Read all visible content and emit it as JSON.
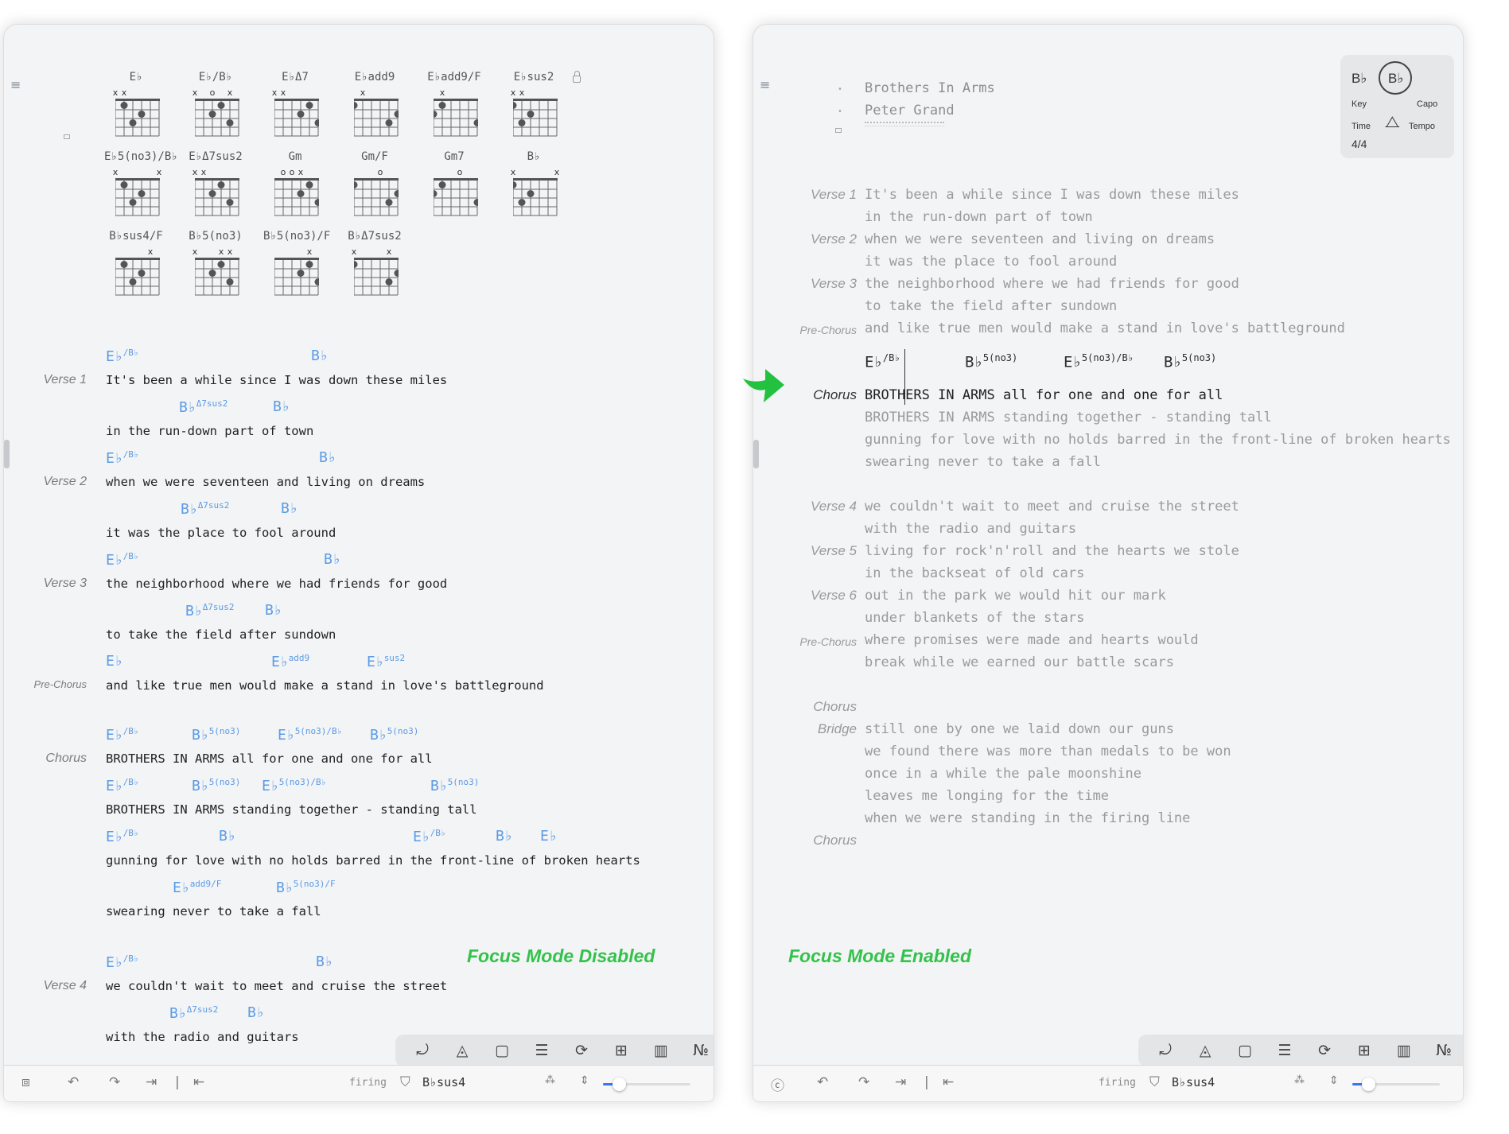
{
  "left": {
    "caption": "Focus Mode Disabled",
    "diagrams": [
      {
        "name": "E♭",
        "mutes": "xx····"
      },
      {
        "name": "E♭/B♭",
        "mutes": "x·o·x·"
      },
      {
        "name": "E♭Δ7",
        "mutes": "xx····"
      },
      {
        "name": "E♭add9",
        "mutes": "·x····"
      },
      {
        "name": "E♭add9/F",
        "mutes": "·x····"
      },
      {
        "name": "E♭sus2",
        "mutes": "xx····"
      },
      {
        "name": "E♭5(no3)/B♭",
        "mutes": "x····x"
      },
      {
        "name": "E♭Δ7sus2",
        "mutes": "xx····"
      },
      {
        "name": "Gm",
        "mutes": "·oox··"
      },
      {
        "name": "Gm/F",
        "mutes": "···o··"
      },
      {
        "name": "Gm7",
        "mutes": "···o··"
      },
      {
        "name": "B♭",
        "mutes": "x····x"
      },
      {
        "name": "B♭sus4/F",
        "mutes": "····x·"
      },
      {
        "name": "B♭5(no3)",
        "mutes": "x··xx·"
      },
      {
        "name": "B♭5(no3)/F",
        "mutes": "····x·"
      },
      {
        "name": "B♭Δ7sus2",
        "mutes": "x···x·"
      }
    ],
    "lines": [
      {
        "label": "Verse 1",
        "chords": [
          "E♭/B♭",
          "B♭"
        ],
        "lyric": "It's been a while since I was down these miles"
      },
      {
        "label": "",
        "chords": [
          "B♭Δ7sus2",
          "B♭"
        ],
        "lyric": "in the run-down part of town"
      },
      {
        "label": "Verse 2",
        "chords": [
          "E♭/B♭",
          "B♭"
        ],
        "lyric": "when we were seventeen and living on dreams"
      },
      {
        "label": "",
        "chords": [
          "B♭Δ7sus2",
          "B♭"
        ],
        "lyric": "it was the place to fool around"
      },
      {
        "label": "Verse 3",
        "chords": [
          "E♭/B♭",
          "B♭"
        ],
        "lyric": "the neighborhood where we had friends for good"
      },
      {
        "label": "",
        "chords": [
          "B♭Δ7sus2",
          "B♭"
        ],
        "lyric": "to take the field after sundown"
      },
      {
        "label": "Pre-Chorus",
        "chords": [
          "E♭",
          "E♭add9",
          "E♭sus2"
        ],
        "lyric": "and like true men would make a stand in love's battleground"
      },
      {
        "label": "Chorus",
        "chords": [
          "E♭/B♭",
          "B♭5(no3)",
          "E♭5(no3)/B♭",
          "B♭5(no3)"
        ],
        "lyric": "BROTHERS IN ARMS all for one and one for all"
      },
      {
        "label": "",
        "chords": [
          "E♭/B♭",
          "B♭5(no3)",
          "E♭5(no3)/B♭",
          "B♭5(no3)"
        ],
        "lyric": "BROTHERS IN ARMS standing together - standing tall"
      },
      {
        "label": "",
        "chords": [
          "E♭/B♭",
          "B♭",
          "E♭/B♭",
          "B♭",
          "E♭"
        ],
        "lyric": "gunning for love with no holds barred in the front-line of broken hearts"
      },
      {
        "label": "",
        "chords": [
          "E♭add9/F",
          "B♭5(no3)/F"
        ],
        "lyric": "swearing never to take a fall"
      },
      {
        "label": "Verse 4",
        "chords": [
          "E♭/B♭",
          "B♭"
        ],
        "lyric": "we couldn't wait to meet and cruise the street"
      },
      {
        "label": "",
        "chords": [
          "B♭Δ7sus2",
          "B♭"
        ],
        "lyric": "with the radio and guitars"
      }
    ]
  },
  "right": {
    "caption": "Focus Mode Enabled",
    "title": "Brothers In Arms",
    "artist": "Peter Grand",
    "info": {
      "key": "B♭",
      "key_label": "Key",
      "capo": "B♭",
      "capo_label": "Capo",
      "time_label": "Time",
      "tempo_label": "Tempo",
      "time": "4/4"
    },
    "sections": [
      {
        "label": "Verse 1",
        "lines": [
          "It's been a while since I was down these miles",
          "in the run-down part of town"
        ]
      },
      {
        "label": "Verse 2",
        "lines": [
          "when we were seventeen and living on dreams",
          "it was the place to fool around"
        ]
      },
      {
        "label": "Verse 3",
        "lines": [
          "the neighborhood where we had friends for good",
          "to take the field after sundown"
        ]
      },
      {
        "label": "Pre-Chorus",
        "lines": [
          "and like true men would make a stand in love's battleground"
        ]
      },
      {
        "label": "Chorus",
        "lines": [
          "BROTHERS IN ARMS all for one and one for all",
          "BROTHERS IN ARMS standing together - standing tall",
          "gunning for love with no holds barred in the front-line of broken hearts",
          "swearing never to take a fall"
        ]
      },
      {
        "label": "Verse 4",
        "lines": [
          "we couldn't wait to meet and cruise the street",
          "with the radio and guitars"
        ]
      },
      {
        "label": "Verse 5",
        "lines": [
          "living for rock'n'roll and the hearts we stole",
          "in the backseat of old cars"
        ]
      },
      {
        "label": "Verse 6",
        "lines": [
          "out in the park we would hit our mark",
          "under blankets of the stars"
        ]
      },
      {
        "label": "Pre-Chorus",
        "lines": [
          "where promises were made and hearts would",
          "break while we earned our battle scars"
        ]
      },
      {
        "label": "Chorus",
        "lines": []
      },
      {
        "label": "Bridge",
        "lines": [
          "still one by one we laid down our guns",
          "we found there was more than medals to be won",
          "once in a while the pale moonshine",
          "leaves me longing for the time",
          "when we were standing in the firing line"
        ]
      },
      {
        "label": "Chorus",
        "lines": []
      }
    ],
    "focus_chords": [
      "E♭/B♭",
      "B♭5(no3)",
      "E♭5(no3)/B♭",
      "B♭5(no3)"
    ]
  },
  "statusbar": {
    "word": "firing",
    "chord": "B♭sus4"
  },
  "toolbar": {
    "tools": [
      "undo-cursor-icon",
      "compass-icon",
      "clipboard-icon",
      "align-icon",
      "refresh-icon",
      "grid-icon",
      "piano-icon",
      "number-icon"
    ],
    "tool_glyphs": [
      "⤾",
      "◬",
      "▢",
      "☰",
      "⟳",
      "⊞",
      "▥",
      "№"
    ]
  },
  "colors": {
    "chord": "#5b9be6",
    "focus_green": "#33c24a"
  }
}
